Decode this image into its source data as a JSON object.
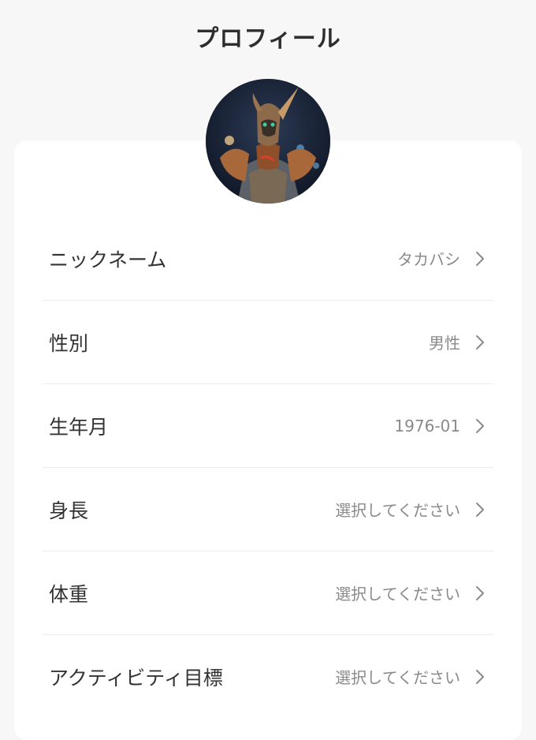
{
  "header": {
    "title": "プロフィール"
  },
  "avatar": {
    "icon": "profile-photo"
  },
  "profile": {
    "rows": [
      {
        "label": "ニックネーム",
        "value": "タカバシ"
      },
      {
        "label": "性別",
        "value": "男性"
      },
      {
        "label": "生年月",
        "value": "1976-01"
      },
      {
        "label": "身長",
        "value": "選択してください"
      },
      {
        "label": "体重",
        "value": "選択してください"
      },
      {
        "label": "アクティビティ目標",
        "value": "選択してください"
      }
    ]
  },
  "icons": {
    "row_arrow": "chevron-right-icon"
  },
  "colors": {
    "background": "#f7f7f7",
    "card": "#ffffff",
    "label": "#333333",
    "value": "#8a8a8a",
    "divider": "#ececec"
  }
}
